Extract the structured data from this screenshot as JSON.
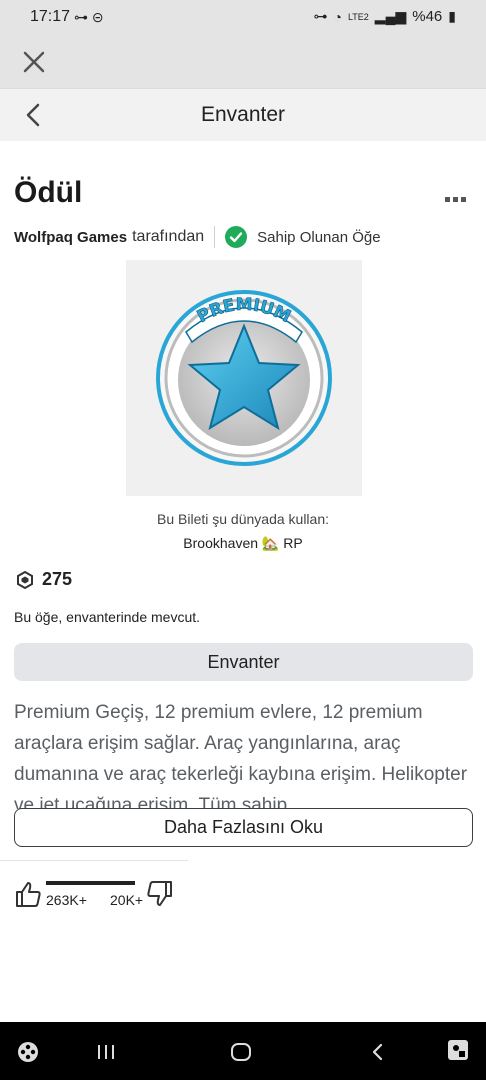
{
  "status_bar": {
    "time": "17:17",
    "battery": "%46",
    "network": "LTE2"
  },
  "nav": {
    "title": "Envanter"
  },
  "item": {
    "title": "Ödül",
    "creator": "Wolfpaq Games",
    "by_label": "tarafından",
    "owned_label": "Sahip Olunan Öğe",
    "badge_text": "PREMIUM",
    "use_line1": "Bu Bileti şu dünyada kullan:",
    "use_line2": "Brookhaven 🏡 RP",
    "price": "275",
    "owned_note": "Bu öğe, envanterinde mevcut.",
    "inventory_button": "Envanter",
    "description": "Premium Geçiş, 12 premium evlere, 12 premium araçlara erişim sağlar. Araç yangınlarına, araç dumanına ve araç tekerleği kaybına erişim. Helikopter ve jet uçağına erişim. Tüm sahip",
    "read_more_button": "Daha Fazlasını Oku",
    "likes": "263K+",
    "dislikes": "20K+",
    "like_ratio": 0.93
  },
  "colors": {
    "accent_green": "#1fab5a",
    "star_blue": "#2aa6d6"
  }
}
